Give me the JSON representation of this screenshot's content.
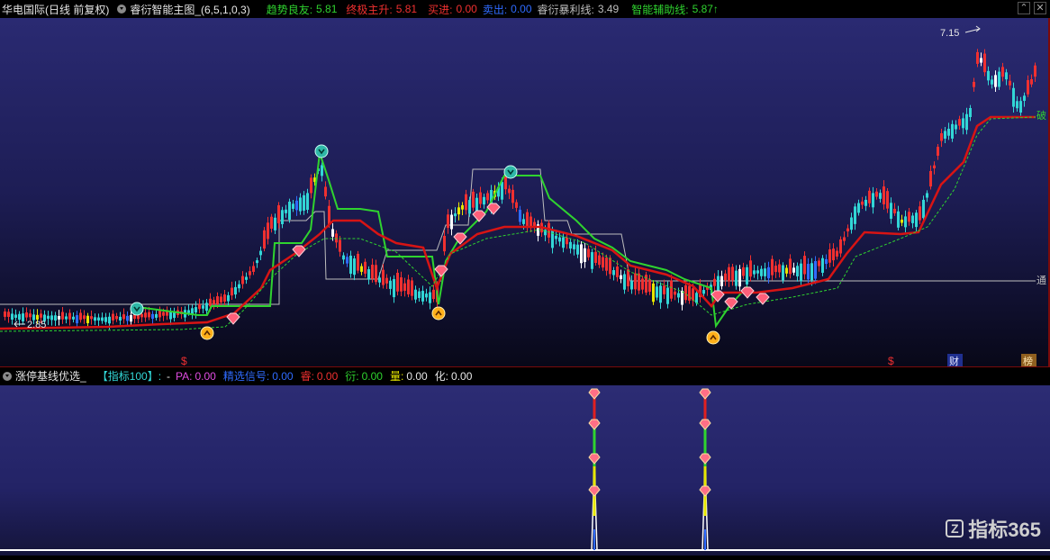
{
  "header": {
    "stock_title": "华电国际(日线 前复权)",
    "main_indicator": "睿衍智能主图_(6,5,1,0,3)",
    "indicators": [
      {
        "label": "趋势良友:",
        "value": "5.81",
        "color": "#2fd32f"
      },
      {
        "label": "终极主升:",
        "value": "5.81",
        "color": "#f03030"
      },
      {
        "label": "买进:",
        "value": "0.00",
        "color": "#f03030"
      },
      {
        "label": "卖出:",
        "value": "0.00",
        "color": "#2f6bff"
      },
      {
        "label": "睿衍暴利线:",
        "value": "3.49",
        "color": "#bdbdbd"
      },
      {
        "label": "智能辅助线:",
        "value": "5.87↑",
        "color": "#2fd32f"
      }
    ]
  },
  "main_chart": {
    "high_label": "7.15",
    "low_label": "2.85",
    "side_label_break": "破",
    "side_label_pass": "通",
    "bottom_markers": [
      "$",
      "$"
    ],
    "bottom_tags": [
      "财",
      "榜"
    ],
    "colors": {
      "support": "#2fd32f",
      "trend": "#d71414",
      "assist": "#2fd32f",
      "guide": "#bdbdbd"
    }
  },
  "sub_header": {
    "title": "涨停基线优选_",
    "bracket": "【指标100】:",
    "fields": [
      {
        "label": "PA:",
        "value": "0.00",
        "color": "#e14ce1"
      },
      {
        "label": "精选信号:",
        "value": "0.00",
        "color": "#2f6bff"
      },
      {
        "label": "睿:",
        "value": "0.00",
        "color": "#f03030"
      },
      {
        "label": "衍:",
        "value": "0.00",
        "color": "#2fd32f"
      },
      {
        "label": "量:",
        "value": "0.00",
        "color": "#e6e600"
      },
      {
        "label": "化:",
        "value": "0.00",
        "color": "#e6e6e6"
      }
    ]
  },
  "watermark": "指标365"
}
